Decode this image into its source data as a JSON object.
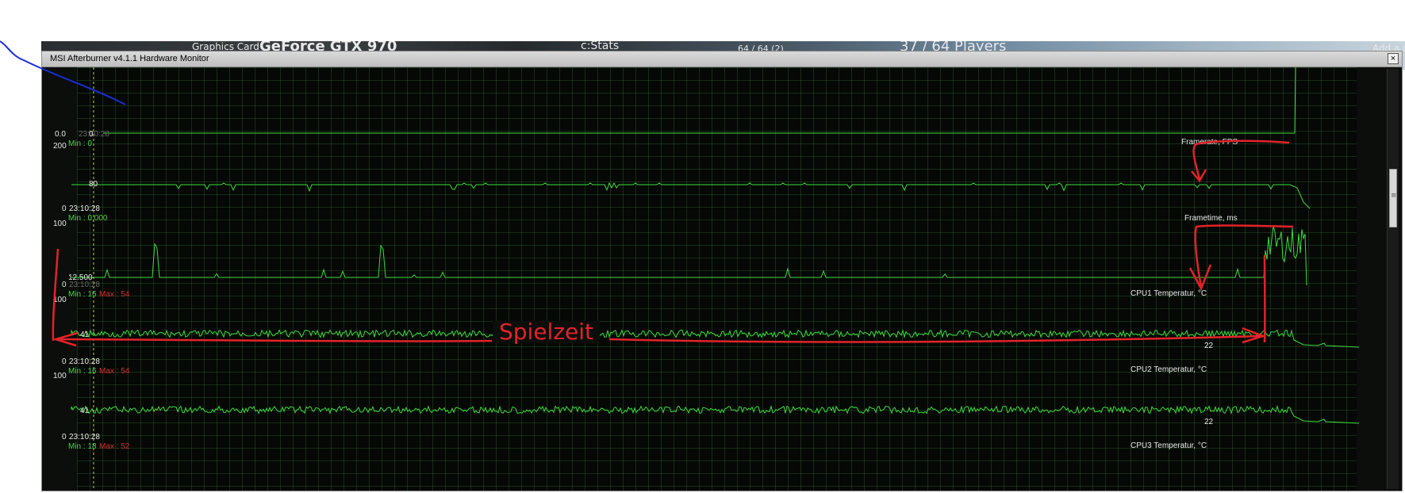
{
  "background_app": {
    "graphics_card_label": "Graphics Card",
    "graphics_card_name": "GeForce GTX 970",
    "stats_label": "c:Stats",
    "slots": "64 / 64 (2)",
    "players": "37 / 64 Players",
    "add_new": "Add a new"
  },
  "window": {
    "title": "MSI Afterburner v4.1.1 Hardware Monitor",
    "close_label": "×"
  },
  "panels": {
    "top": {
      "axis_zero": "0.0",
      "time": "23:10:28",
      "current": "0",
      "min_text": "Min : 0"
    },
    "framerate": {
      "name": "Framerate, FPS",
      "axis_max": "200",
      "axis_min": "0",
      "time": "23:10:28",
      "current": "80",
      "min_text": "Min : 0.000"
    },
    "frametime": {
      "name": "Frametime, ms",
      "axis_max": "100",
      "axis_min": "0",
      "time": "23:10:28",
      "current": "12.500",
      "min_text": "Min : 16",
      "max_text": "Max : 54"
    },
    "cpu1": {
      "name": "CPU1 Temperatur, °C",
      "axis_max": "100",
      "axis_min": "0",
      "time": "23:10:28",
      "current": "41",
      "end_value": "22",
      "min_text": "Min : 16",
      "max_text": "Max : 54"
    },
    "cpu2": {
      "name": "CPU2 Temperatur, °C",
      "axis_max": "100",
      "axis_min": "0",
      "time": "23:10:28",
      "current": "41",
      "end_value": "22",
      "min_text": "Min : 18",
      "max_text": "Max : 52"
    },
    "cpu3": {
      "name": "CPU3 Temperatur, °C"
    }
  },
  "annotation": {
    "label": "Spielzeit",
    "color": "#e4222a"
  },
  "colors": {
    "graph_line": "#3cdc3c",
    "grid": "#2b4a2b",
    "window_bg": "#0b0e0b",
    "annotation_red": "#e4222a",
    "scribble_blue": "#1a2ed0"
  }
}
